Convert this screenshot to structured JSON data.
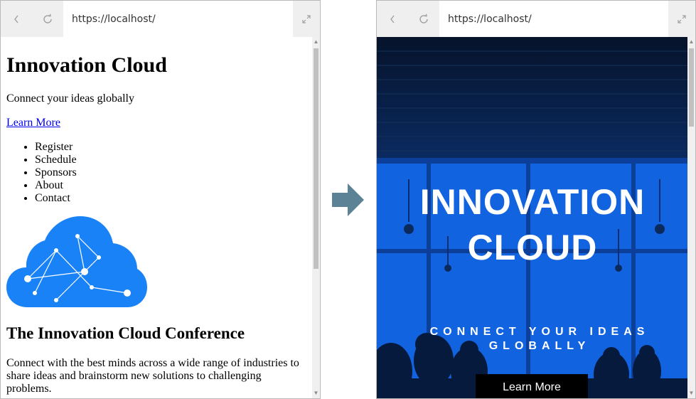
{
  "left_browser": {
    "url": "https://localhost/",
    "page": {
      "title": "Innovation Cloud",
      "tagline": "Connect your ideas globally",
      "learn_more": "Learn More",
      "nav": [
        "Register",
        "Schedule",
        "Sponsors",
        "About",
        "Contact"
      ],
      "section_title": "The Innovation Cloud Conference",
      "description": "Connect with the best minds across a wide range of industries to share ideas and brainstorm new solutions to challenging problems."
    }
  },
  "right_browser": {
    "url": "https://localhost/",
    "hero": {
      "title_line1": "INNOVATION",
      "title_line2": "CLOUD",
      "tagline": "CONNECT YOUR IDEAS GLOBALLY",
      "button": "Learn More"
    }
  },
  "colors": {
    "cloud_blue": "#1a82f7",
    "hero_blue": "#1263e0",
    "arrow": "#5b8395"
  },
  "icons": {
    "back": "back-chevron-icon",
    "reload": "reload-icon",
    "expand": "expand-icon",
    "arrow": "right-arrow-icon"
  }
}
